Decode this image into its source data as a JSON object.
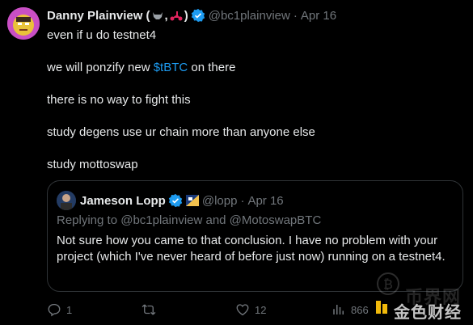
{
  "tweet": {
    "author_name": "Danny Plainview (",
    "author_name_sep": ",",
    "author_name_close": ")",
    "handle": "@bc1plainview",
    "dot": "·",
    "date": "Apr 16",
    "lines": [
      "even if u do testnet4",
      "on there",
      "there is no way to fight this",
      "study degens use ur chain more than anyone else",
      "study mottoswap"
    ],
    "line2_prefix": "we will ponzify new ",
    "cashtag": "$tBTC",
    "line2_suffix": " on there"
  },
  "quote": {
    "author_name": "Jameson Lopp",
    "handle": "@lopp",
    "dot": "·",
    "date": "Apr 16",
    "replying_to": "Replying to @bc1plainview and @MotoswapBTC",
    "body": "Not sure how you came to that conclusion. I have no problem with your project (which I've never heard of before just now) running on a testnet4."
  },
  "actions": {
    "replies": "1",
    "reposts": "",
    "likes": "12",
    "views": "866"
  },
  "watermark": {
    "text_back": "币界网",
    "text_front": "金色财经"
  },
  "colors": {
    "background": "#000000",
    "text": "#e7e9ea",
    "muted": "#71767b",
    "accent": "#1d9bf0",
    "border": "#2f3336"
  }
}
